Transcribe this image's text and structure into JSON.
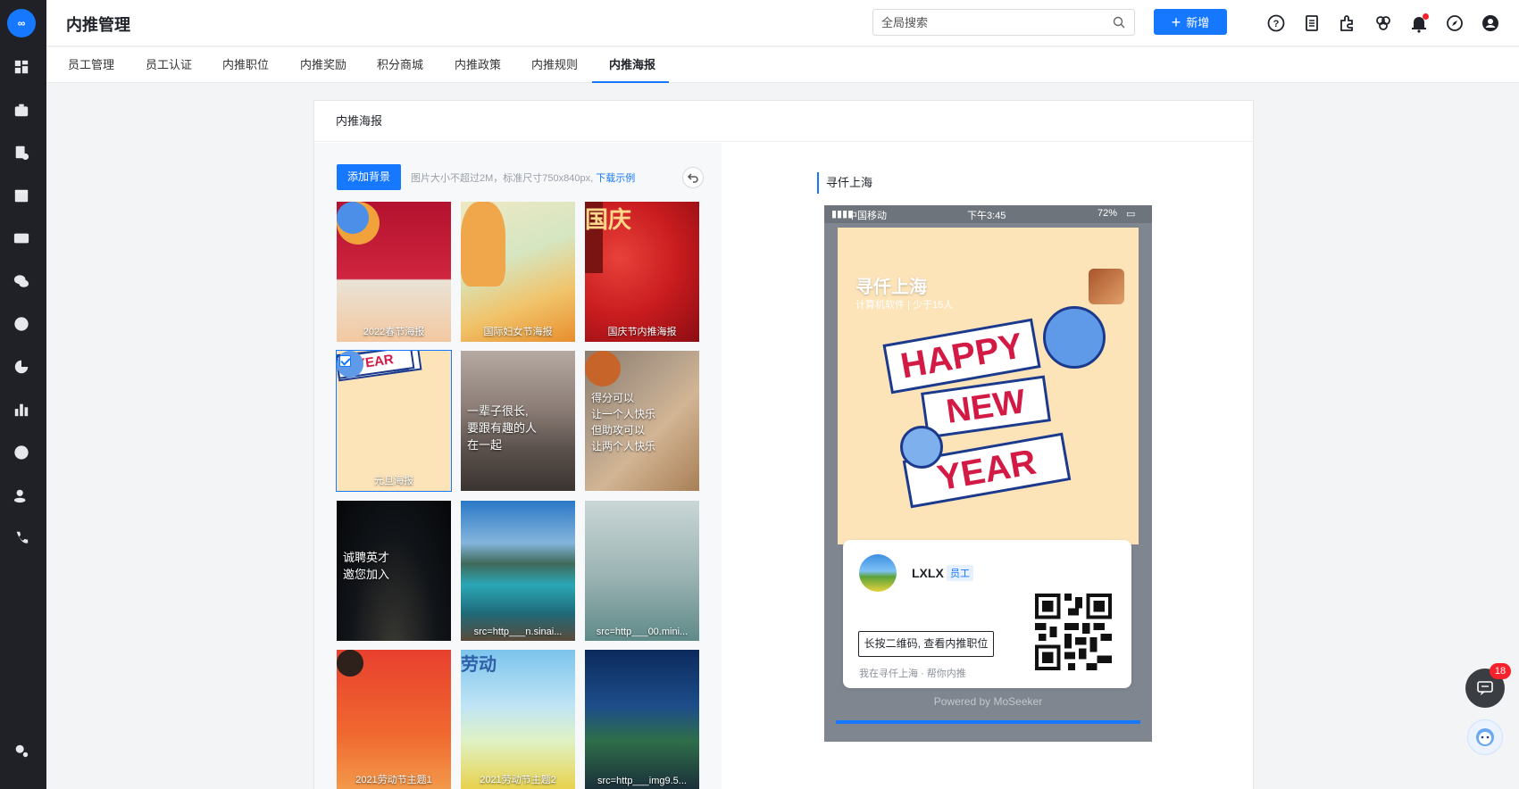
{
  "app": {
    "title": "内推管理",
    "logo_text": "∞"
  },
  "header": {
    "search_placeholder": "全局搜索",
    "add_label": "新增",
    "icons": [
      "help-icon",
      "document-icon",
      "puzzle-icon",
      "clover-icon",
      "bell-icon",
      "compass-icon",
      "user-icon"
    ]
  },
  "nav": {
    "tabs": [
      "员工管理",
      "员工认证",
      "内推职位",
      "内推奖励",
      "积分商城",
      "内推政策",
      "内推规则",
      "内推海报"
    ],
    "active": "内推海报"
  },
  "card": {
    "title": "内推海报",
    "add_bg_label": "添加背景",
    "hint_text": "图片大小不超过2M，标准尺寸750x840px,",
    "hint_link": "下载示例"
  },
  "thumbnails": [
    {
      "caption": "2022春节海报",
      "overlay": ""
    },
    {
      "caption": "国际妇女节海报",
      "overlay": ""
    },
    {
      "caption": "国庆节内推海报",
      "overlay": ""
    },
    {
      "caption": "元旦海报",
      "overlay": "",
      "selected": true
    },
    {
      "caption": "",
      "overlay": "一辈子很长,\n要跟有趣的人\n在一起"
    },
    {
      "caption": "",
      "overlay": "得分可以\n让一个人快乐\n但助攻可以\n让两个人快乐"
    },
    {
      "caption": "",
      "overlay": "诚聘英才\n邀您加入"
    },
    {
      "caption": "src=http___n.sinai...",
      "overlay": ""
    },
    {
      "caption": "src=http___00.mini...",
      "overlay": ""
    },
    {
      "caption": "2021劳动节主题1",
      "overlay": ""
    },
    {
      "caption": "2021劳动节主题2",
      "overlay": ""
    },
    {
      "caption": "src=http___img9.5...",
      "overlay": ""
    }
  ],
  "preview": {
    "label": "寻仟上海",
    "status_carrier": "中国移动",
    "status_time": "下午3:45",
    "status_battery": "72%",
    "company": "寻仟上海",
    "meta": "计算机软件   |   少于15人",
    "poster_text": [
      "HAPPY",
      "NEW",
      "YEAR"
    ],
    "user_name": "LXLX",
    "user_tag": "员工",
    "press_label": "长按二维码, 查看内推职位",
    "tagline": "我在寻仟上海 · 帮你内推",
    "powered": "Powered by MoSeeker"
  },
  "floating": {
    "badge": "18"
  },
  "colors": {
    "primary": "#1677ff",
    "rail": "#1f2126",
    "danger": "#f5222d"
  }
}
